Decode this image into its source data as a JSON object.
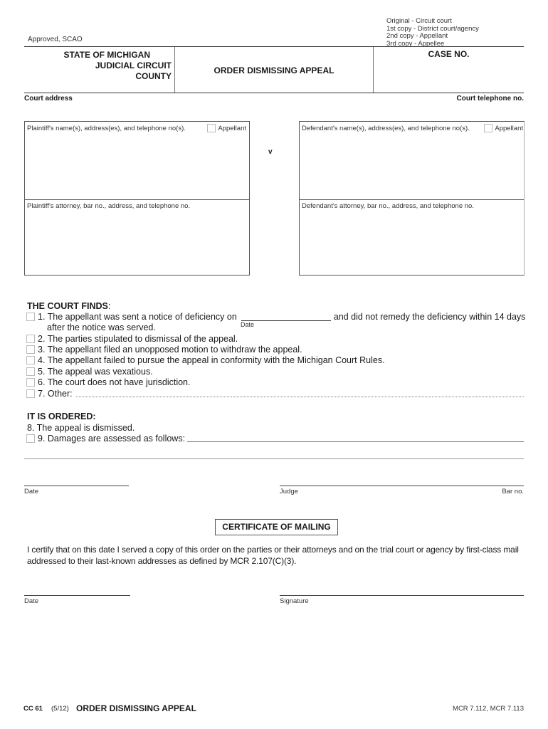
{
  "header": {
    "approved": "Approved, SCAO",
    "copies": [
      "Original - Circuit court",
      "1st copy - District court/agency",
      "2nd copy - Appellant",
      "3rd copy - Appellee"
    ],
    "state_lines": [
      "STATE OF MICHIGAN",
      "JUDICIAL CIRCUIT",
      "COUNTY"
    ],
    "form_title": "ORDER DISMISSING APPEAL",
    "case_no_label": "CASE NO.",
    "court_address_label": "Court  address",
    "court_telephone_label": "Court telephone  no."
  },
  "parties": {
    "plaintiff_label": "Plaintiff's name(s), address(es), and telephone no(s).",
    "plaintiff_attorney_label": "Plaintiff's attorney, bar no., address, and telephone no.",
    "defendant_label": "Defendant's name(s), address(es), and telephone no(s).",
    "defendant_attorney_label": "Defendant's attorney, bar no., address, and telephone no.",
    "appellant_label": "Appellant",
    "versus": "v"
  },
  "findings": {
    "heading": "THE COURT FINDS",
    "heading_colon": ":",
    "items": [
      {
        "text": "1. The appellant was sent a notice of deficiency on",
        "suffix": "and did not remedy the deficiency within 14 days",
        "continuation": "after the notice was served.",
        "date_caption": "Date"
      },
      {
        "text": "2. The parties stipulated to dismissal of the appeal."
      },
      {
        "text": "3. The appellant filed an unopposed motion to withdraw the appeal."
      },
      {
        "text": "4. The appellant failed to pursue the appeal in conformity with the Michigan Court Rules."
      },
      {
        "text": "5. The appeal was vexatious."
      },
      {
        "text": "6. The court does not have jurisdiction."
      },
      {
        "text": "7. Other:"
      }
    ]
  },
  "ordered": {
    "heading": "IT IS ORDERED:",
    "item8": "8. The appeal is dismissed.",
    "item9": "9. Damages are assessed as follows:"
  },
  "signature": {
    "date_label": "Date",
    "judge_label": "Judge",
    "bar_no_label": "Bar no."
  },
  "certificate": {
    "title": "CERTIFICATE OF MAILING",
    "text": "I certify that on this date I served a copy of this order on the parties or their attorneys and on the trial court or agency by first-class mail addressed to their last-known addresses as defined by MCR 2.107(C)(3).",
    "date_label": "Date",
    "signature_label": "Signature"
  },
  "footer": {
    "form_code": "CC 61",
    "revision": "(5/12)",
    "title": "ORDER DISMISSING APPEAL",
    "rules": "MCR 7.112, MCR 7.113"
  }
}
